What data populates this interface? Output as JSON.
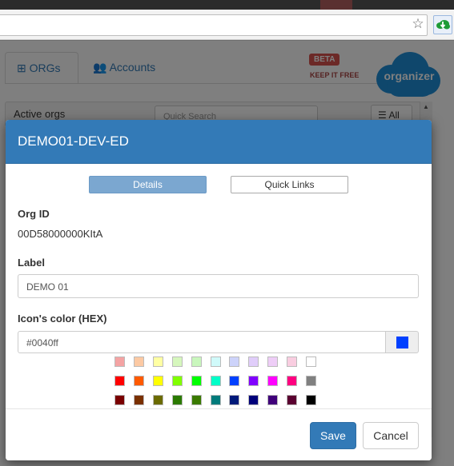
{
  "browser": {
    "star_icon": "star-outline-icon",
    "extension_icon": "cloud-download-icon"
  },
  "background": {
    "tabs": [
      {
        "label": "ORGs",
        "icon": "sitemap-icon"
      },
      {
        "label": "Accounts",
        "icon": "users-icon"
      }
    ],
    "beta_badge": "BETA",
    "keep_free": "KEEP IT FREE",
    "logo_text": "organizer",
    "panel_label": "Active orgs",
    "search_placeholder": "Quick Search",
    "all_button": "All"
  },
  "modal": {
    "title": "DEMO01-DEV-ED",
    "tabs": [
      {
        "label": "Details",
        "active": true
      },
      {
        "label": "Quick Links",
        "active": false
      }
    ],
    "org_id_label": "Org ID",
    "org_id_value": "00D58000000KItA",
    "label_label": "Label",
    "label_value": "DEMO 01",
    "color_label": "Icon's color (HEX)",
    "color_value": "#0040ff",
    "current_color": "#0040ff",
    "palette": [
      [
        "#f4a3a3",
        "#fcc9a3",
        "#ffffa3",
        "#d6f7bd",
        "#c9f7bd",
        "#d0fafa",
        "#cdd3fa",
        "#e0cdfa",
        "#eecdf7",
        "#f9cde0",
        "#ffffff"
      ],
      [
        "#ff0000",
        "#ff5a00",
        "#ffff00",
        "#80ff00",
        "#00ff00",
        "#00ffc8",
        "#0040ff",
        "#8000ff",
        "#ff00ff",
        "#ff0080",
        "#808080"
      ],
      [
        "#7a0000",
        "#7a3000",
        "#6b6b00",
        "#2b7a00",
        "#3a7a00",
        "#007a7a",
        "#001a7a",
        "#00007a",
        "#40007a",
        "#5a0030",
        "#000000"
      ]
    ],
    "save_label": "Save",
    "cancel_label": "Cancel"
  }
}
